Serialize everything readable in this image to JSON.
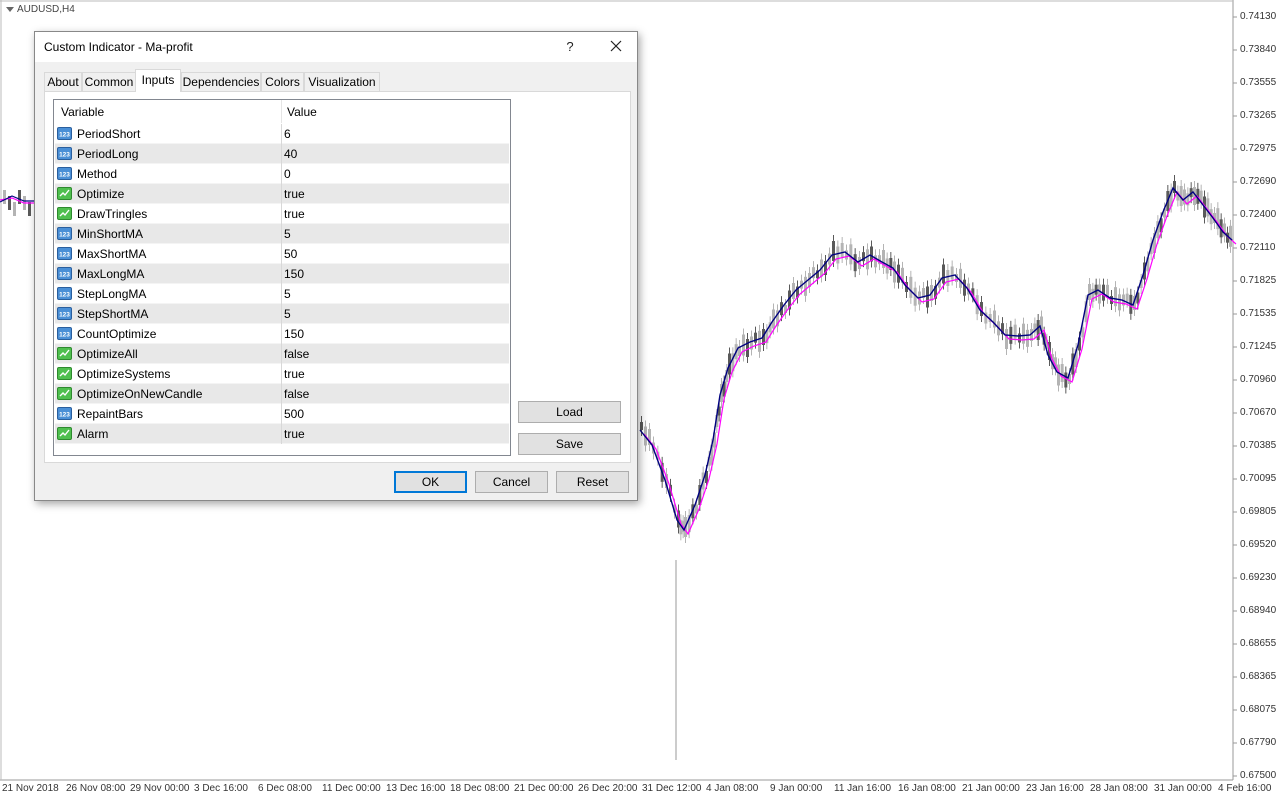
{
  "chart": {
    "symbol_label": "AUDUSD,H4",
    "price_labels": [
      "0.74130",
      "0.73840",
      "0.73555",
      "0.73265",
      "0.72975",
      "0.72690",
      "0.72400",
      "0.72110",
      "0.71825",
      "0.71535",
      "0.71245",
      "0.70960",
      "0.70670",
      "0.70385",
      "0.70095",
      "0.69805",
      "0.69520",
      "0.69230",
      "0.68940",
      "0.68655",
      "0.68365",
      "0.68075",
      "0.67790",
      "0.67500"
    ],
    "time_labels": [
      "21 Nov 2018",
      "26 Nov 08:00",
      "29 Nov 00:00",
      "3 Dec 16:00",
      "6 Dec 08:00",
      "11 Dec 00:00",
      "13 Dec 16:00",
      "18 Dec 08:00",
      "21 Dec 00:00",
      "26 Dec 20:00",
      "31 Dec 12:00",
      "4 Jan 08:00",
      "9 Jan 00:00",
      "11 Jan 16:00",
      "16 Jan 08:00",
      "21 Jan 00:00",
      "23 Jan 16:00",
      "28 Jan 08:00",
      "31 Jan 00:00",
      "4 Feb 16:00"
    ],
    "colors": {
      "ma_short": "#000080",
      "ma_long": "#ff00ff",
      "candle_up": "#b4b4b4",
      "candle_down": "#5a5a5a"
    }
  },
  "dialog": {
    "title": "Custom Indicator - Ma-profit",
    "help_label": "?",
    "tabs": [
      "About",
      "Common",
      "Inputs",
      "Dependencies",
      "Colors",
      "Visualization"
    ],
    "active_tab": "Inputs",
    "grid": {
      "headers": {
        "variable": "Variable",
        "value": "Value"
      },
      "rows": [
        {
          "variable": "PeriodShort",
          "value": "6",
          "type": "int"
        },
        {
          "variable": "PeriodLong",
          "value": "40",
          "type": "int"
        },
        {
          "variable": "Method",
          "value": "0",
          "type": "int"
        },
        {
          "variable": "Optimize",
          "value": "true",
          "type": "bool"
        },
        {
          "variable": "DrawTringles",
          "value": "true",
          "type": "bool"
        },
        {
          "variable": "MinShortMA",
          "value": "5",
          "type": "int"
        },
        {
          "variable": "MaxShortMA",
          "value": "50",
          "type": "int"
        },
        {
          "variable": "MaxLongMA",
          "value": "150",
          "type": "int"
        },
        {
          "variable": "StepLongMA",
          "value": "5",
          "type": "int"
        },
        {
          "variable": "StepShortMA",
          "value": "5",
          "type": "int"
        },
        {
          "variable": "CountOptimize",
          "value": "150",
          "type": "int"
        },
        {
          "variable": "OptimizeAll",
          "value": "false",
          "type": "bool"
        },
        {
          "variable": "OptimizeSystems",
          "value": "true",
          "type": "bool"
        },
        {
          "variable": "OptimizeOnNewCandle",
          "value": "false",
          "type": "bool"
        },
        {
          "variable": "RepaintBars",
          "value": "500",
          "type": "int"
        },
        {
          "variable": "Alarm",
          "value": "true",
          "type": "bool"
        }
      ]
    },
    "buttons": {
      "load": "Load",
      "save": "Save",
      "ok": "OK",
      "cancel": "Cancel",
      "reset": "Reset"
    }
  }
}
